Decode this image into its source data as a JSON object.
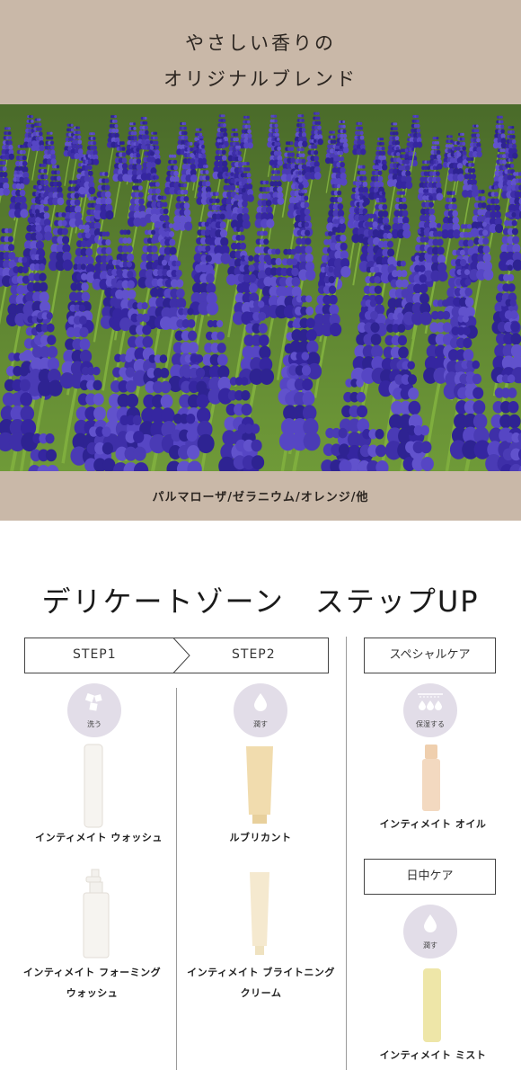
{
  "banner": {
    "line1": "やさしい香りの",
    "line2": "オリジナルブレンド"
  },
  "photo": {
    "caption": "パルマローザ/ゼラニウム/オレンジ/他"
  },
  "heading": "デリケートゾーン　ステップUP",
  "steps": [
    {
      "label": "STEP1"
    },
    {
      "label": "STEP2"
    }
  ],
  "special": {
    "label": "スペシャルケア"
  },
  "daytime": {
    "label": "日中ケア"
  },
  "circles": {
    "wash": {
      "icon": "wash-icon",
      "text": "洗う"
    },
    "moisturize": {
      "icon": "water-drop-icon",
      "text": "潤す"
    },
    "retain": {
      "icon": "moisture-retention-icon",
      "text": "保湿する"
    },
    "moisturize2": {
      "icon": "water-drop-icon",
      "text": "潤す"
    }
  },
  "products": {
    "wash": "インティメイト ウォッシュ",
    "foam_line1": "インティメイト フォーミング",
    "foam_line2": "ウォッシュ",
    "lubricant": "ルブリカント",
    "cream_line1": "インティメイト ブライトニング",
    "cream_line2": "クリーム",
    "oil": "インティメイト オイル",
    "mist": "インティメイト ミスト"
  },
  "colors": {
    "banner": "#c9b8a8",
    "circle": "#e2dde8",
    "flower": "#4a3bb5",
    "tube": "#f1dcae",
    "oil": "#f3d9c0",
    "mist": "#eee6a8"
  }
}
